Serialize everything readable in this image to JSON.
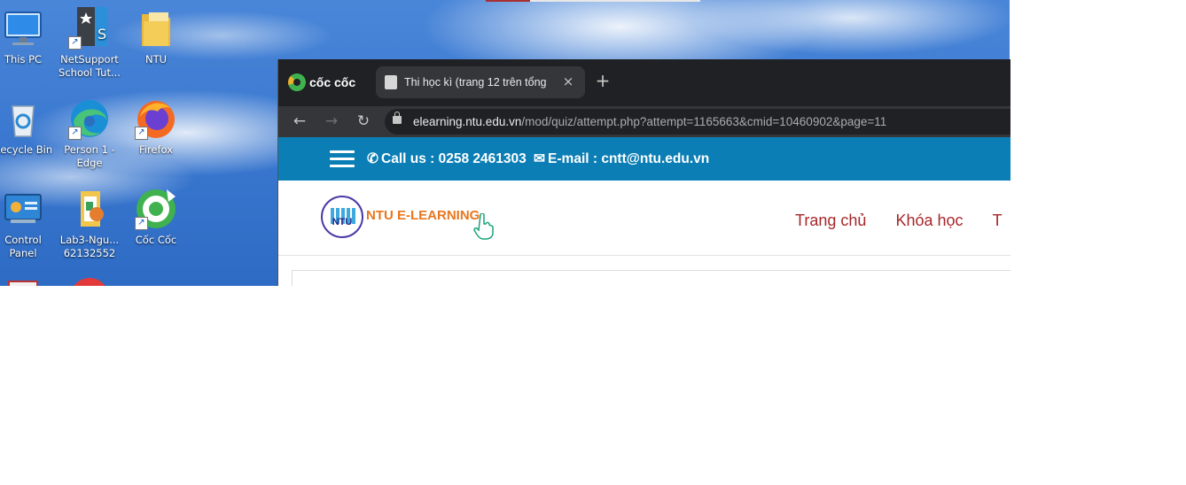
{
  "desktop": {
    "icons": [
      {
        "label": "This PC",
        "icon": "computer-icon"
      },
      {
        "label": "NetSupport School Tut...",
        "icon": "netsupport-icon"
      },
      {
        "label": "NTU",
        "icon": "folder-icon"
      },
      {
        "label": "Recycle Bin",
        "icon": "recycle-bin-icon"
      },
      {
        "label": "Person 1 - Edge",
        "icon": "edge-icon"
      },
      {
        "label": "Firefox",
        "icon": "firefox-icon"
      },
      {
        "label": "Control Panel",
        "icon": "control-panel-icon"
      },
      {
        "label": "Lab3-Ngu... 62132552",
        "icon": "document-icon"
      },
      {
        "label": "Cốc Cốc",
        "icon": "coccoc-icon"
      }
    ]
  },
  "browser": {
    "brand": "cốc cốc",
    "tab": {
      "title": "Thi học kì (trang 12 trên tổng",
      "close": "×"
    },
    "new_tab": "+",
    "nav": {
      "back": "←",
      "forward": "→",
      "reload": "↻"
    },
    "address": {
      "domain": "elearning.ntu.edu.vn",
      "path": "/mod/quiz/attempt.php?attempt=1165663&cmid=10460902&page=11"
    }
  },
  "site": {
    "contact": {
      "phone_label": "Call us : 0258 2461303",
      "email_label": "E-mail : cntt@ntu.edu.vn"
    },
    "logo_text": "NTU E-LEARNING",
    "logo_seal": "NTU",
    "menu": [
      "Trang chủ",
      "Khóa học",
      "T"
    ]
  },
  "colors": {
    "topbar": "#0b7eb5",
    "menu_link": "#a6262a",
    "logo_text": "#e8761f",
    "tabstrip": "#202124"
  }
}
